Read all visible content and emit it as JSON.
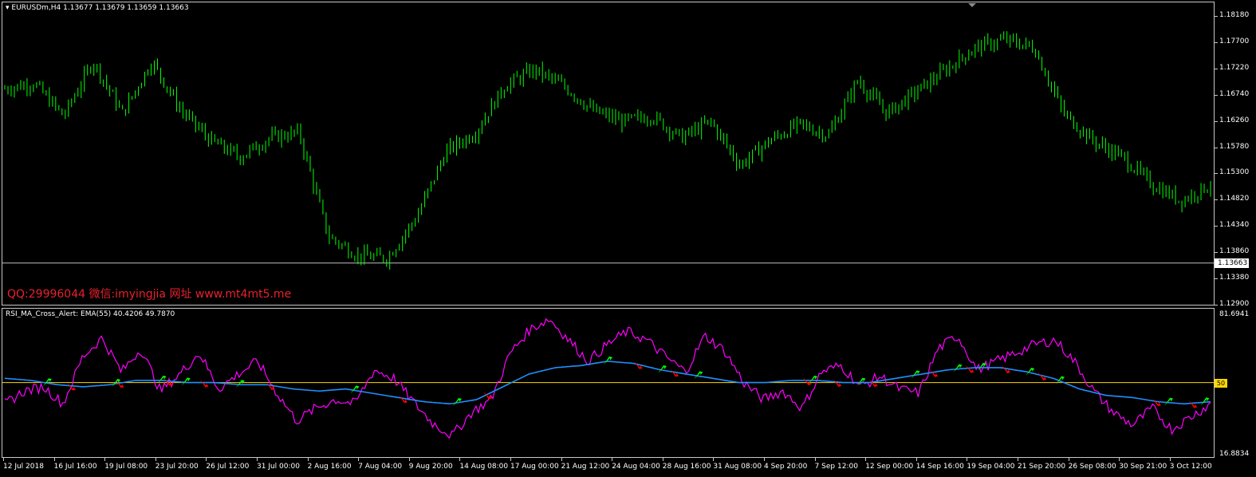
{
  "main_chart": {
    "title": "EURUSDm,H4  1.13677 1.13679 1.13659 1.13663",
    "current_price": "1.13663",
    "y_labels": [
      "1.18180",
      "1.17700",
      "1.17220",
      "1.16740",
      "1.16260",
      "1.15780",
      "1.15300",
      "1.14820",
      "1.14340",
      "1.13860",
      "1.13380",
      "1.12900"
    ],
    "watermark": "QQ:29996044 微信:imyingjia 网址 www.mt4mt5.me",
    "colors": {
      "candle": "#00ff00",
      "price_line": "#c0c0c0",
      "watermark": "#e8212c"
    }
  },
  "indicator": {
    "title": "RSI_MA_Cross_Alert: EMA(55) 40.4206 49.7870",
    "max_label": "81.6941",
    "min_label": "16.8834",
    "level_label": "50",
    "colors": {
      "rsi": "#ff00ff",
      "ema": "#1e90ff",
      "level": "#ffd700",
      "buy_arrow": "#00ff00",
      "sell_arrow": "#ff0000"
    }
  },
  "time_axis": [
    "12 Jul 2018",
    "16 Jul 16:00",
    "19 Jul 08:00",
    "23 Jul 20:00",
    "26 Jul 12:00",
    "31 Jul 00:00",
    "2 Aug 16:00",
    "7 Aug 04:00",
    "9 Aug 20:00",
    "14 Aug 08:00",
    "17 Aug 00:00",
    "21 Aug 12:00",
    "24 Aug 04:00",
    "28 Aug 16:00",
    "31 Aug 08:00",
    "4 Sep 20:00",
    "7 Sep 12:00",
    "12 Sep 00:00",
    "14 Sep 16:00",
    "19 Sep 04:00",
    "21 Sep 20:00",
    "26 Sep 08:00",
    "30 Sep 21:00",
    "3 Oct 12:00"
  ],
  "chart_data": [
    {
      "type": "line",
      "title": "EURUSDm,H4",
      "xlabel": "",
      "ylabel": "",
      "ylim": [
        1.129,
        1.1818
      ],
      "x": [
        "12 Jul 2018",
        "16 Jul 16:00",
        "19 Jul 08:00",
        "23 Jul 20:00",
        "26 Jul 12:00",
        "31 Jul 00:00",
        "2 Aug 16:00",
        "7 Aug 04:00",
        "9 Aug 20:00",
        "14 Aug 08:00",
        "17 Aug 00:00",
        "21 Aug 12:00",
        "24 Aug 04:00",
        "28 Aug 16:00",
        "31 Aug 08:00",
        "4 Sep 20:00",
        "7 Sep 12:00",
        "12 Sep 00:00",
        "14 Sep 16:00",
        "19 Sep 04:00",
        "21 Sep 20:00",
        "26 Sep 08:00",
        "30 Sep 21:00",
        "3 Oct 12:00"
      ],
      "series": [
        {
          "values": [
            1.1685,
            1.1695,
            1.1635,
            1.1735,
            1.164,
            1.1735,
            1.1645,
            1.159,
            1.156,
            1.1595,
            1.1605,
            1.1415,
            1.138,
            1.1375,
            1.145,
            1.157,
            1.1605,
            1.169,
            1.172,
            1.169,
            1.1645,
            1.1625,
            1.1635,
            1.1595,
            1.1625,
            1.1545,
            1.159,
            1.162,
            1.16,
            1.17,
            1.164,
            1.168,
            1.172,
            1.176,
            1.1775,
            1.176,
            1.164,
            1.159,
            1.156,
            1.151,
            1.148,
            1.151
          ]
        }
      ]
    },
    {
      "type": "line",
      "title": "RSI_MA_Cross_Alert: EMA(55)",
      "xlabel": "",
      "ylabel": "",
      "ylim": [
        16.8834,
        81.6941
      ],
      "level": 50,
      "x": [
        "12 Jul 2018",
        "16 Jul 16:00",
        "19 Jul 08:00",
        "23 Jul 20:00",
        "26 Jul 12:00",
        "31 Jul 00:00",
        "2 Aug 16:00",
        "7 Aug 04:00",
        "9 Aug 20:00",
        "14 Aug 08:00",
        "17 Aug 00:00",
        "21 Aug 12:00",
        "24 Aug 04:00",
        "28 Aug 16:00",
        "31 Aug 08:00",
        "4 Sep 20:00",
        "7 Sep 12:00",
        "12 Sep 00:00",
        "14 Sep 16:00",
        "19 Sep 04:00",
        "21 Sep 20:00",
        "26 Sep 08:00",
        "30 Sep 21:00",
        "3 Oct 12:00"
      ],
      "series": [
        {
          "values": [
            40,
            46,
            48,
            40,
            62,
            71,
            55,
            66,
            46,
            54,
            64,
            47,
            54,
            60,
            45,
            32,
            38,
            42,
            40,
            56,
            52,
            41,
            31,
            25,
            36,
            42,
            64,
            75,
            80,
            70,
            60,
            68,
            74,
            70,
            62,
            55,
            72,
            65,
            50,
            42,
            46,
            38,
            55,
            58,
            48,
            53,
            47,
            45,
            66,
            72,
            56,
            60,
            64,
            68,
            70,
            60,
            46,
            36,
            30,
            38,
            28,
            34,
            40
          ]
        },
        {
          "values": [
            52,
            51,
            49,
            48,
            49,
            51,
            51,
            50,
            50,
            49,
            49,
            47,
            46,
            47,
            45,
            43,
            41,
            40,
            42,
            48,
            54,
            57,
            58,
            60,
            59,
            56,
            54,
            52,
            50,
            50,
            51,
            51,
            50,
            50,
            52,
            54,
            56,
            57,
            57,
            55,
            52,
            47,
            44,
            43,
            41,
            40,
            41
          ]
        }
      ]
    }
  ]
}
